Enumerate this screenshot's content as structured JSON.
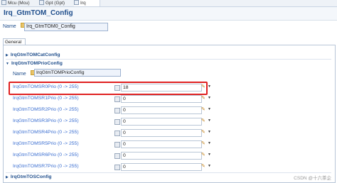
{
  "tabs": [
    {
      "label": "Mcu (Mcu)"
    },
    {
      "label": "Gpt (Gpt)"
    },
    {
      "label": "Irq (Irq)"
    }
  ],
  "header": {
    "title": "Irq_GtmTOM_Config"
  },
  "name_field": {
    "label": "Name",
    "value": "Irq_GtmTOM0_Config"
  },
  "section_tab": "General",
  "groups": {
    "cat": "IrqGtmTOMCatConfig",
    "prio": "IrqGtmTOMPrioConfig",
    "tos": "IrqGtmTOSConfig"
  },
  "sub_name": {
    "label": "Name",
    "value": "IrqGtmTOMPrioConfig"
  },
  "rows": [
    {
      "label": "IrqGtmTOMSR0Prio (0 -> 255)",
      "value": "18"
    },
    {
      "label": "IrqGtmTOMSR1Prio (0 -> 255)",
      "value": "0"
    },
    {
      "label": "IrqGtmTOMSR2Prio (0 -> 255)",
      "value": "0"
    },
    {
      "label": "IrqGtmTOMSR3Prio (0 -> 255)",
      "value": "0"
    },
    {
      "label": "IrqGtmTOMSR4Prio (0 -> 255)",
      "value": "0"
    },
    {
      "label": "IrqGtmTOMSR5Prio (0 -> 255)",
      "value": "0"
    },
    {
      "label": "IrqGtmTOMSR6Prio (0 -> 255)",
      "value": "0"
    },
    {
      "label": "IrqGtmTOMSR7Prio (0 -> 255)",
      "value": "0"
    }
  ],
  "watermark": "CSDN @十六茶企",
  "colors": {
    "highlight": "#e02020",
    "title": "#1f4e8c",
    "label_link": "#3a6ed1"
  }
}
